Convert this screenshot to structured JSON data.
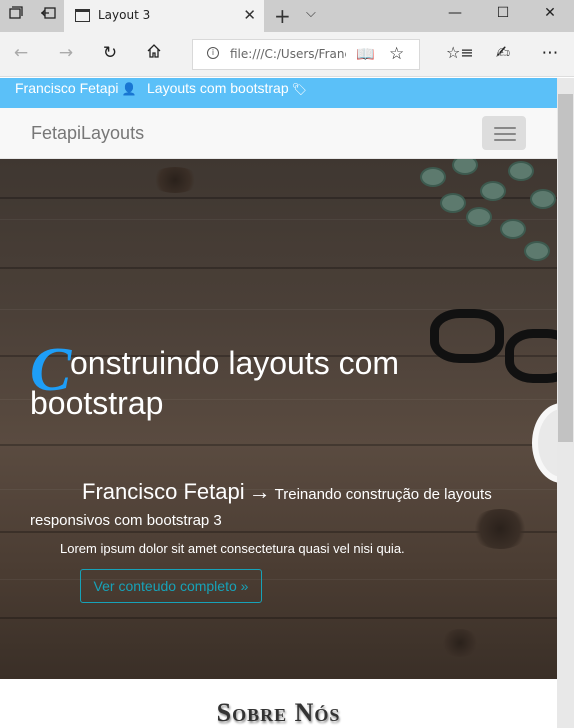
{
  "browser": {
    "tab_title": "Layout 3",
    "address": "file:///C:/Users/Franc",
    "icons": [
      "tab-preview-icon",
      "set-aside-tabs-icon",
      "page-icon",
      "close-icon",
      "new-tab-icon",
      "tab-list-icon",
      "minimize-icon",
      "maximize-icon",
      "close-window-icon",
      "back-icon",
      "forward-icon",
      "refresh-icon",
      "home-icon",
      "info-icon",
      "reading-view-icon",
      "favorite-star-icon",
      "favorites-hub-icon",
      "pen-icon",
      "more-icon"
    ]
  },
  "page": {
    "topbar": {
      "author": "Francisco Fetapi",
      "project": "Layouts com bootstrap",
      "color": "#5bc0f8"
    },
    "brand": "FetapiLayouts",
    "hero": {
      "dropcap": "C",
      "title_rest": "onstruindo layouts com bootstrap",
      "sub_name": "Francisco Fetapi",
      "sub_arrow": "→",
      "sub_rest": "Treinando construção de layouts responsivos com bootstrap 3",
      "lorem": "Lorem ipsum dolor sit amet consectetura quasi vel nisi quia.",
      "button": "Ver conteudo completo »",
      "accent": "#1e9ef7",
      "button_color": "#17a2b8"
    },
    "section_title": "Sobre Nós"
  }
}
